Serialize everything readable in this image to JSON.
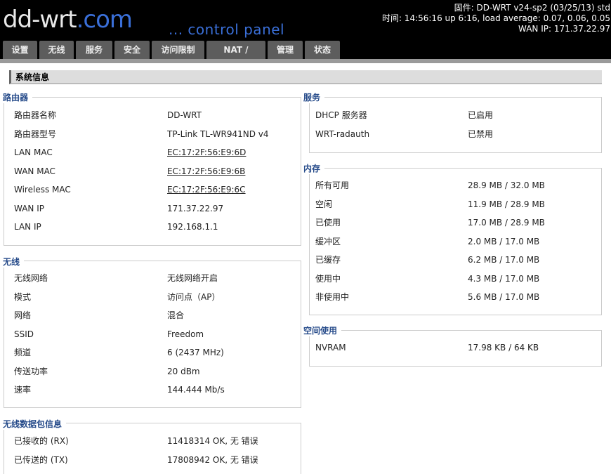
{
  "header": {
    "logo_main": "dd-wrt",
    "logo_com": ".com",
    "tagline": "... control panel",
    "firmware": "固件: DD-WRT v24-sp2 (03/25/13) std",
    "time": "时间: 14:56:16 up 6:16, load average: 0.07, 0.06, 0.05",
    "wan_ip": "WAN IP: 171.37.22.97"
  },
  "tabs": [
    "设置",
    "无线",
    "服务",
    "安全",
    "访问限制",
    "NAT / QoS",
    "管理",
    "状态"
  ],
  "page_title": "系统信息",
  "router": {
    "title": "路由器",
    "rows": [
      {
        "k": "路由器名称",
        "v": "DD-WRT"
      },
      {
        "k": "路由器型号",
        "v": "TP-Link TL-WR941ND v4"
      },
      {
        "k": "LAN MAC",
        "v": "EC:17:2F:56:E9:6D"
      },
      {
        "k": "WAN MAC",
        "v": "EC:17:2F:56:E9:6B"
      },
      {
        "k": "Wireless MAC",
        "v": "EC:17:2F:56:E9:6C"
      },
      {
        "k": "WAN IP",
        "v": "171.37.22.97"
      },
      {
        "k": "LAN IP",
        "v": "192.168.1.1"
      }
    ]
  },
  "wireless": {
    "title": "无线",
    "rows": [
      {
        "k": "无线网络",
        "v": "无线网络开启"
      },
      {
        "k": "模式",
        "v": "访问点（AP）"
      },
      {
        "k": "网络",
        "v": "混合"
      },
      {
        "k": "SSID",
        "v": "Freedom"
      },
      {
        "k": "频道",
        "v": "6 (2437 MHz)"
      },
      {
        "k": "传送功率",
        "v": "20 dBm"
      },
      {
        "k": "速率",
        "v": "144.444 Mb/s"
      }
    ]
  },
  "packets": {
    "title": "无线数据包信息",
    "rows": [
      {
        "k": "已接收的 (RX)",
        "v": "11418314 OK, 无 错误"
      },
      {
        "k": "已传送的 (TX)",
        "v": "17808942 OK, 无 错误"
      }
    ]
  },
  "services": {
    "title": "服务",
    "rows": [
      {
        "k": "DHCP 服务器",
        "v": "已启用"
      },
      {
        "k": "WRT-radauth",
        "v": "已禁用"
      }
    ]
  },
  "memory": {
    "title": "内存",
    "rows": [
      {
        "k": "所有可用",
        "v": "28.9 MB / 32.0 MB"
      },
      {
        "k": "空闲",
        "v": "11.9 MB / 28.9 MB"
      },
      {
        "k": "已使用",
        "v": "17.0 MB / 28.9 MB"
      },
      {
        "k": "缓冲区",
        "v": "2.0 MB / 17.0 MB"
      },
      {
        "k": "已缓存",
        "v": "6.2 MB / 17.0 MB"
      },
      {
        "k": "使用中",
        "v": "4.3 MB / 17.0 MB"
      },
      {
        "k": "非使用中",
        "v": "5.6 MB / 17.0 MB"
      }
    ]
  },
  "space": {
    "title": "空间使用",
    "rows": [
      {
        "k": "NVRAM",
        "v": "17.98 KB / 64 KB"
      }
    ]
  }
}
